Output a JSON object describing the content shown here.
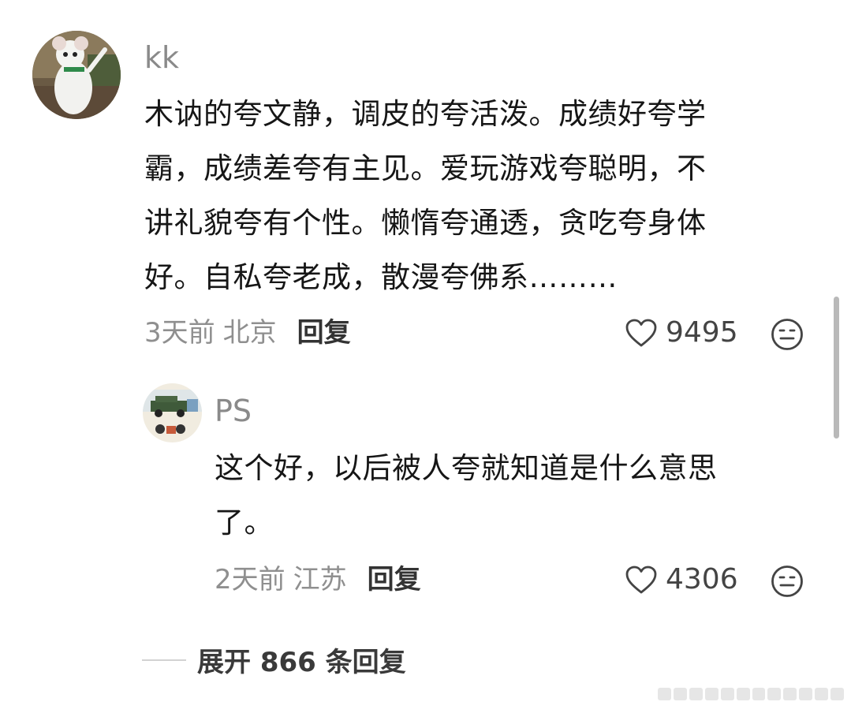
{
  "comments": [
    {
      "username": "kk",
      "avatar": "mouse-mascot-avatar",
      "lines": [
        "木讷的夸文静，调皮的夸活泼。成绩好夸学",
        "霸，成绩差夸有主见。爱玩游戏夸聪明，不",
        "讲礼貌夸有个性。懒惰夸通透，贪吃夸身体",
        "好。自私夸老成，散漫夸佛系………"
      ],
      "time": "3天前",
      "location": "北京",
      "reply_label": "回复",
      "likes": "9495"
    },
    {
      "username": "PS",
      "avatar": "jeep-illustration-avatar",
      "lines": [
        "这个好，以后被人夸就知道是什么意思",
        "了。"
      ],
      "time": "2天前",
      "location": "江苏",
      "reply_label": "回复",
      "likes": "4306"
    }
  ],
  "expand_label": "展开 866 条回复",
  "icons": {
    "like": "heart-outline-icon",
    "reaction": "neutral-face-icon"
  },
  "colors": {
    "text": "#161616",
    "meta": "#8f8f8f",
    "username": "#8a8a8a"
  }
}
